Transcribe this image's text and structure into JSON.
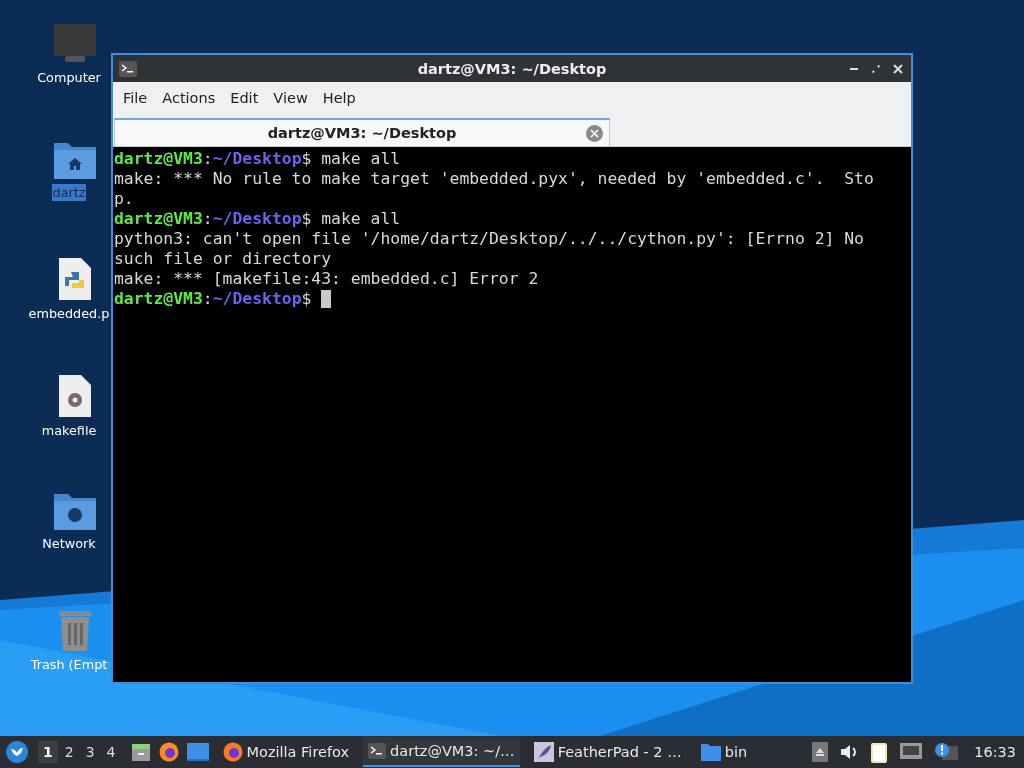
{
  "desktop_icons": [
    {
      "label": "Computer",
      "kind": "computer",
      "selected": false
    },
    {
      "label": "dartz",
      "kind": "home",
      "selected": true
    },
    {
      "label": "embedded.p",
      "kind": "python",
      "selected": false
    },
    {
      "label": "makefile",
      "kind": "script",
      "selected": false
    },
    {
      "label": "Network",
      "kind": "network",
      "selected": false
    },
    {
      "label": "Trash (Empt",
      "kind": "trash",
      "selected": false
    }
  ],
  "window": {
    "title": "dartz@VM3: ~/Desktop",
    "menu": [
      "File",
      "Actions",
      "Edit",
      "View",
      "Help"
    ],
    "tabs": [
      {
        "label": "dartz@VM3: ~/Desktop",
        "selected": true
      }
    ],
    "terminal": {
      "lines": [
        {
          "kind": "prompt",
          "user": "dartz@VM3",
          "sep": ":",
          "path": "~/Desktop",
          "symbol": "$",
          "command": "make all"
        },
        {
          "kind": "output",
          "text": "make: *** No rule to make target 'embedded.pyx', needed by 'embedded.c'.  Sto"
        },
        {
          "kind": "output",
          "text": "p."
        },
        {
          "kind": "prompt",
          "user": "dartz@VM3",
          "sep": ":",
          "path": "~/Desktop",
          "symbol": "$",
          "command": "make all"
        },
        {
          "kind": "output",
          "text": "python3: can't open file '/home/dartz/Desktop/../../cython.py': [Errno 2] No"
        },
        {
          "kind": "output",
          "text": "such file or directory"
        },
        {
          "kind": "output",
          "text": "make: *** [makefile:43: embedded.c] Error 2"
        },
        {
          "kind": "prompt",
          "user": "dartz@VM3",
          "sep": ":",
          "path": "~/Desktop",
          "symbol": "$",
          "cursor": true
        }
      ]
    }
  },
  "taskbar": {
    "workspaces": [
      {
        "label": "1",
        "selected": true
      },
      {
        "label": "2",
        "selected": false
      },
      {
        "label": "3",
        "selected": false
      },
      {
        "label": "4",
        "selected": false
      }
    ],
    "tasks": [
      {
        "label": "Mozilla Firefox",
        "kind": "firefox",
        "selected": false
      },
      {
        "label": "dartz@VM3: ~/…",
        "kind": "terminal",
        "selected": true
      },
      {
        "label": "FeatherPad - 2 …",
        "kind": "feather",
        "selected": false
      },
      {
        "label": "bin",
        "kind": "folder",
        "selected": false
      }
    ],
    "clock": "16:33"
  }
}
